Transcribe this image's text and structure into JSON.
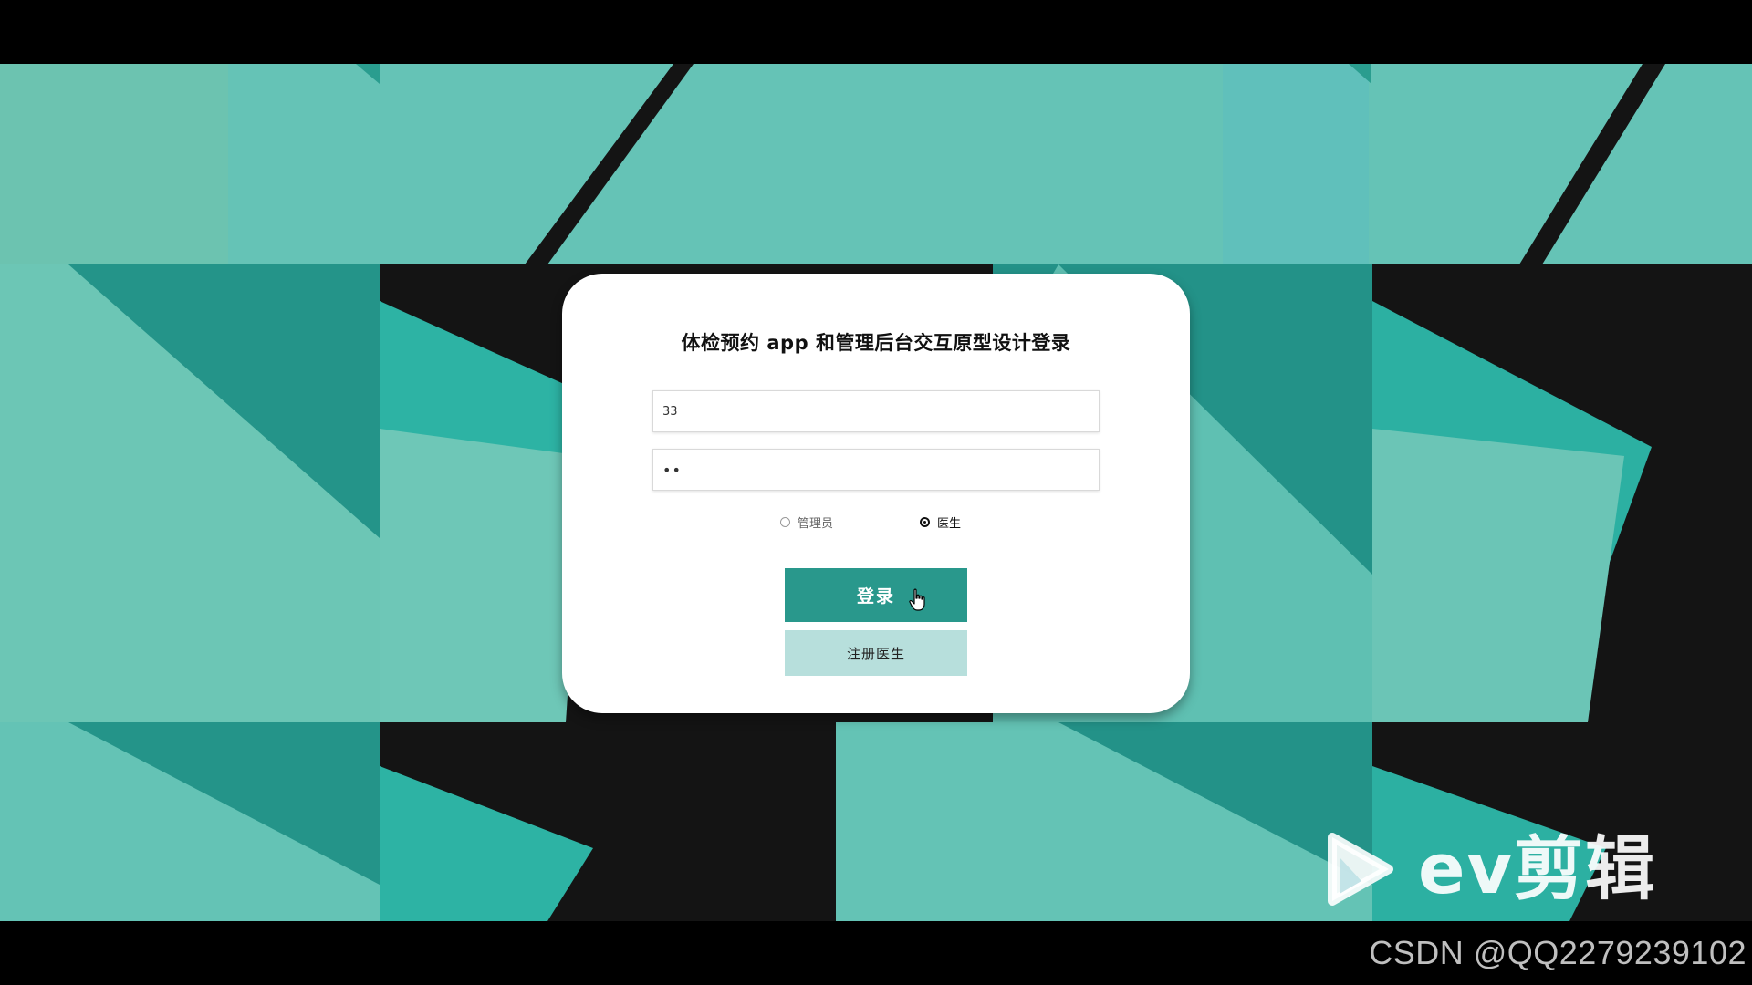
{
  "login": {
    "title": "体检预约 app 和管理后台交互原型设计登录",
    "username_value": "33",
    "password_value": "••",
    "roles": [
      {
        "label": "管理员",
        "selected": false
      },
      {
        "label": "医生",
        "selected": true
      }
    ],
    "login_label": "登录",
    "register_label": "注册医生"
  },
  "watermarks": {
    "ev_logo_text": "ev剪辑",
    "csdn_text": "CSDN @QQ2279239102"
  },
  "icons": {
    "cursor": "hand-pointer-icon",
    "ev_play": "play-triangle-icon"
  },
  "colors": {
    "primary": "#29988c",
    "secondary": "#b7dfdc",
    "background_teal": "#66c2b4",
    "background_dark": "#141414"
  }
}
